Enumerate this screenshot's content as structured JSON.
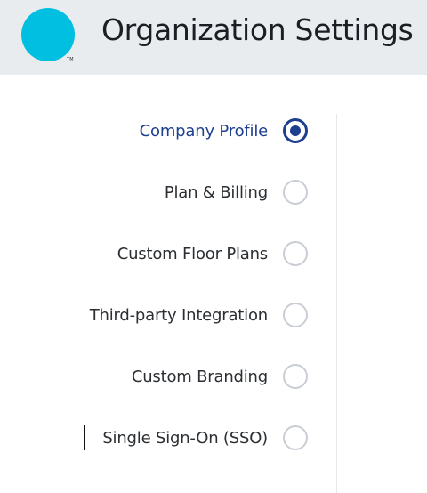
{
  "header": {
    "logo_mark": "TM",
    "title": "Organization Settings"
  },
  "colors": {
    "accent": "#1e3f8f",
    "logo": "#00bfe0",
    "header_bg": "#e9ecef"
  },
  "nav": {
    "items": [
      {
        "label": "Company Profile",
        "selected": true
      },
      {
        "label": "Plan & Billing",
        "selected": false
      },
      {
        "label": "Custom Floor Plans",
        "selected": false
      },
      {
        "label": "Third-party Integration",
        "selected": false
      },
      {
        "label": "Custom Branding",
        "selected": false
      },
      {
        "label": "Single Sign-On (SSO)",
        "selected": false
      }
    ]
  }
}
